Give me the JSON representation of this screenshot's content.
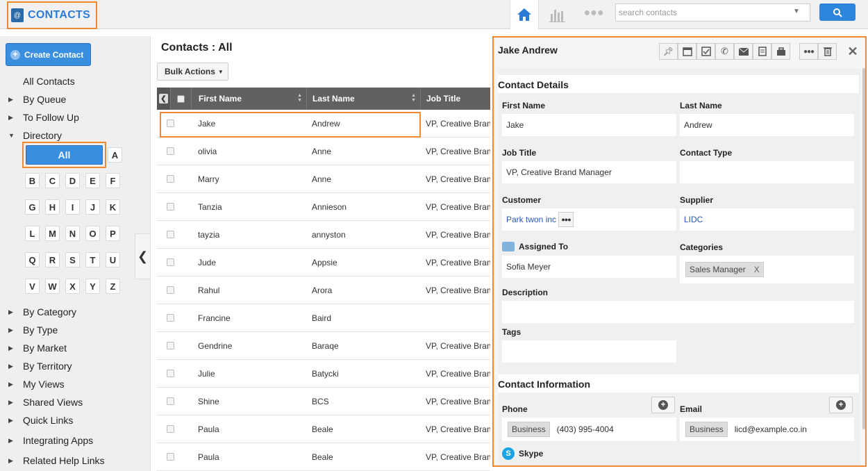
{
  "app": {
    "title": "CONTACTS"
  },
  "search": {
    "placeholder": "search contacts"
  },
  "sidebar": {
    "create_label": "Create Contact",
    "items": [
      "All Contacts",
      "By Queue",
      "To Follow Up",
      "Directory",
      "By Category",
      "By Type",
      "By Market",
      "By Territory",
      "My Views",
      "Shared Views",
      "Quick Links",
      "Integrating Apps",
      "Related Help Links"
    ],
    "directory_all": "All",
    "letters": [
      "A",
      "B",
      "C",
      "D",
      "E",
      "F",
      "G",
      "H",
      "I",
      "J",
      "K",
      "L",
      "M",
      "N",
      "O",
      "P",
      "Q",
      "R",
      "S",
      "T",
      "U",
      "V",
      "W",
      "X",
      "Y",
      "Z"
    ]
  },
  "main": {
    "title": "Contacts : All",
    "bulk_label": "Bulk Actions",
    "columns": [
      "First Name",
      "Last Name",
      "Job Title"
    ],
    "rows": [
      [
        "Jake",
        "Andrew",
        "VP, Creative Brand Manager"
      ],
      [
        "olivia",
        "Anne",
        "VP, Creative Brand Manager"
      ],
      [
        "Marry",
        "Anne",
        "VP, Creative Brand Manager"
      ],
      [
        "Tanzia",
        "Annieson",
        "VP, Creative Brand Manager"
      ],
      [
        "tayzia",
        "annyston",
        "VP, Creative Brand Manager"
      ],
      [
        "Jude",
        "Appsie",
        "VP, Creative Brand Manager"
      ],
      [
        "Rahul",
        "Arora",
        "VP, Creative Brand Manager"
      ],
      [
        "Francine",
        "Baird",
        ""
      ],
      [
        "Gendrine",
        "Baraqe",
        "VP, Creative Brand Manager"
      ],
      [
        "Julie",
        "Batycki",
        "VP, Creative Brand Manager"
      ],
      [
        "Shine",
        "BCS",
        "VP, Creative Brand Manager"
      ],
      [
        "Paula",
        "Beale",
        "VP, Creative Brand Manager"
      ],
      [
        "Paula",
        "Beale",
        "VP, Creative Brand Manager"
      ]
    ]
  },
  "panel": {
    "name": "Jake Andrew",
    "details_title": "Contact Details",
    "first_name_label": "First Name",
    "first_name": "Jake",
    "last_name_label": "Last Name",
    "last_name": "Andrew",
    "job_title_label": "Job Title",
    "job_title": "VP, Creative Brand Manager",
    "contact_type_label": "Contact Type",
    "contact_type": "",
    "customer_label": "Customer",
    "customer": "Park twon inc",
    "supplier_label": "Supplier",
    "supplier": "LIDC",
    "assigned_label": "Assigned To",
    "assigned": "Sofia Meyer",
    "categories_label": "Categories",
    "category_tag": "Sales Manager",
    "category_remove": "X",
    "description_label": "Description",
    "tags_label": "Tags",
    "info_title": "Contact Information",
    "phone_label": "Phone",
    "phone_type": "Business",
    "phone": "(403) 995-4004",
    "email_label": "Email",
    "email_type": "Business",
    "email": "licd@example.co.in",
    "skype_label": "Skype"
  },
  "colors": {
    "accent": "#2d86dc",
    "highlight": "#f0882f",
    "header": "#616161"
  }
}
